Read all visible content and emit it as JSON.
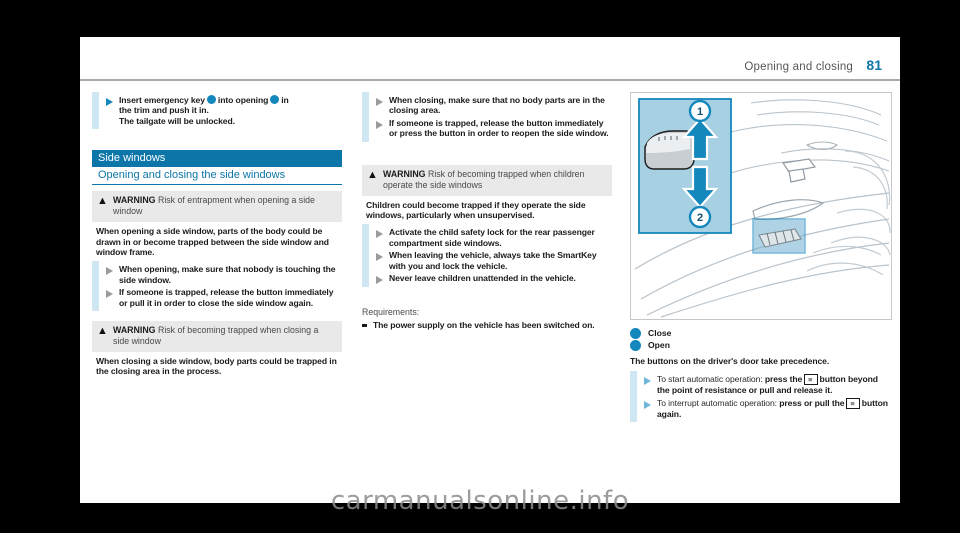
{
  "header": {
    "title": "Opening and closing",
    "page": "81"
  },
  "col1": {
    "intro": {
      "line1_a": "Insert emergency key",
      "line1_b": "into opening",
      "line1_c": "in",
      "line2": "the trim and push it in.",
      "line3": "The tailgate will be unlocked."
    },
    "section_bar": "Side windows",
    "section_sub": "Opening and closing the side windows",
    "warning1": {
      "label": "WARNING",
      "title": "Risk of entrapment when opening a side window",
      "lead": "When opening a side window, parts of the body could be drawn in or become trapped between the side window and window frame.",
      "bullets": [
        "When opening, make sure that nobody is touching the side window.",
        "If someone is trapped, release the button immediately or pull it in order to close the side window again."
      ]
    },
    "warning2": {
      "label": "WARNING",
      "title": "Risk of becoming trapped when closing a side window",
      "lead": "When closing a side window, body parts could be trapped in the closing area in the process."
    }
  },
  "col2": {
    "bullets_top": [
      "When closing, make sure that no body parts are in the closing area.",
      "If someone is trapped, release the button immediately or press the button in order to reopen the side window."
    ],
    "warning3": {
      "label": "WARNING",
      "title": "Risk of becoming trapped when children operate the side windows",
      "lead": "Children could become trapped if they operate the side windows, particularly when unsupervised.",
      "bullets": [
        "Activate the child safety lock for the rear passenger compartment side windows.",
        "When leaving the vehicle, always take the SmartKey with you and lock the vehicle.",
        "Never leave children unattended in the vehicle."
      ]
    },
    "requirements_title": "Requirements:",
    "requirements": [
      "The power supply on the vehicle has been switched on."
    ]
  },
  "col3": {
    "figure": {
      "callout_1": "1",
      "callout_2": "2"
    },
    "legend": [
      {
        "marker": "1",
        "label": "Close"
      },
      {
        "marker": "2",
        "label": "Open"
      }
    ],
    "note": "The buttons on the driver's door take precedence.",
    "bullets": [
      {
        "prefix": "To start automatic operation:",
        "bold_a": "press the",
        "key": "≡",
        "bold_b": "button beyond the point of resistance or pull and release it."
      },
      {
        "prefix": "To interrupt automatic operation:",
        "bold_a": "press or pull the",
        "key": "≡",
        "bold_b": "button again."
      }
    ]
  },
  "watermark": "carmanualsonline.info",
  "colors": {
    "accent": "#0c76a8",
    "accent_light": "#cfe7f3",
    "dot": "#1487bd",
    "warn_bg": "#e9e9e9"
  }
}
